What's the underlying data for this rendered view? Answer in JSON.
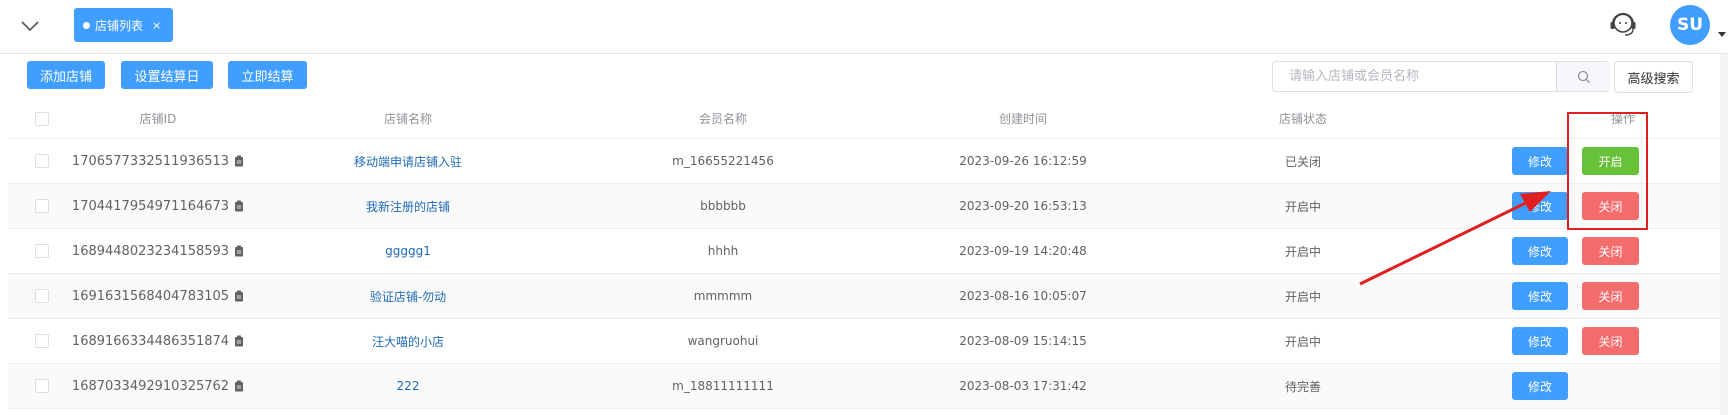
{
  "header": {
    "tab": {
      "label": "店铺列表",
      "close": "×"
    },
    "avatar_text": "SU"
  },
  "toolbar": {
    "add_shop": "添加店铺",
    "set_settlement_day": "设置结算日",
    "settle_now": "立即结算",
    "search_placeholder": "请输入店铺或会员名称",
    "advanced_search": "高级搜索"
  },
  "table": {
    "columns": [
      "店铺ID",
      "店铺名称",
      "会员名称",
      "创建时间",
      "店铺状态",
      "操作"
    ],
    "rows": [
      {
        "id": "1706577332511936513",
        "name": "移动端申请店铺入驻",
        "member": "m_16655221456",
        "created": "2023-09-26 16:12:59",
        "status": "已关闭",
        "edit": "修改",
        "toggle": "开启",
        "toggle_type": "open"
      },
      {
        "id": "1704417954971164673",
        "name": "我新注册的店铺",
        "member": "bbbbbb",
        "created": "2023-09-20 16:53:13",
        "status": "开启中",
        "edit": "修改",
        "toggle": "关闭",
        "toggle_type": "close"
      },
      {
        "id": "1689448023234158593",
        "name": "ggggg1",
        "member": "hhhh",
        "created": "2023-09-19 14:20:48",
        "status": "开启中",
        "edit": "修改",
        "toggle": "关闭",
        "toggle_type": "close"
      },
      {
        "id": "1691631568404783105",
        "name": "验证店铺-勿动",
        "member": "mmmmm",
        "created": "2023-08-16 10:05:07",
        "status": "开启中",
        "edit": "修改",
        "toggle": "关闭",
        "toggle_type": "close"
      },
      {
        "id": "1689166334486351874",
        "name": "汪大喵的小店",
        "member": "wangruohui",
        "created": "2023-08-09 15:14:15",
        "status": "开启中",
        "edit": "修改",
        "toggle": "关闭",
        "toggle_type": "close"
      },
      {
        "id": "1687033492910325762",
        "name": "222",
        "member": "m_18811111111",
        "created": "2023-08-03 17:31:42",
        "status": "待完善",
        "edit": "修改",
        "toggle": "",
        "toggle_type": "none"
      }
    ]
  },
  "colors": {
    "primary": "#409eff",
    "success": "#67c23a",
    "danger": "#f56c6c",
    "annotation": "#e02020"
  }
}
